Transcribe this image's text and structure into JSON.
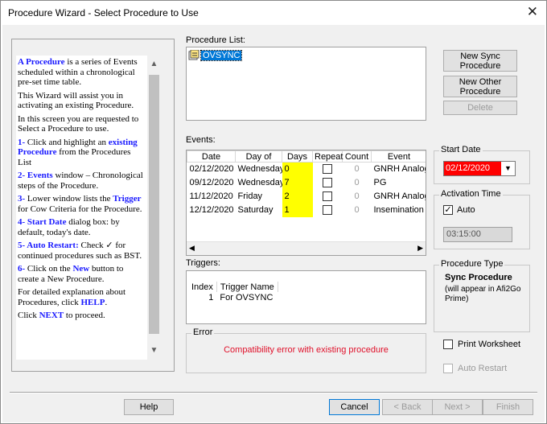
{
  "window": {
    "title": "Procedure Wizard - Select Procedure to Use",
    "close_glyph": "✕"
  },
  "help": [
    {
      "parts": [
        {
          "t": "A Procedure",
          "b": true
        },
        {
          "t": " is a series of Events scheduled within a chronological pre-set time table."
        }
      ]
    },
    {
      "parts": [
        {
          "t": "This Wizard will assist you in activating an existing Procedure."
        }
      ]
    },
    {
      "parts": [
        {
          "t": "In this screen you are requested to Select a Procedure to use."
        }
      ]
    },
    {
      "parts": [
        {
          "t": "1- ",
          "b": true
        },
        {
          "t": "Click and highlight an "
        },
        {
          "t": "existing Procedure",
          "b": true
        },
        {
          "t": " from the Procedures List"
        }
      ]
    },
    {
      "parts": [
        {
          "t": "2- Events",
          "b": true
        },
        {
          "t": " window – Chronological steps of the Procedure."
        }
      ]
    },
    {
      "parts": [
        {
          "t": "3- ",
          "b": true
        },
        {
          "t": "Lower window lists the "
        },
        {
          "t": "Trigger",
          "b": true
        },
        {
          "t": " for Cow Criteria for the Procedure."
        }
      ]
    },
    {
      "parts": [
        {
          "t": "4- Start Date",
          "b": true
        },
        {
          "t": " dialog box: by default, today's date."
        }
      ]
    },
    {
      "parts": [
        {
          "t": "5- Auto Restart:",
          "b": true
        },
        {
          "t": " Check ✓ for continued procedures such as BST."
        }
      ]
    },
    {
      "parts": [
        {
          "t": "6- ",
          "b": true
        },
        {
          "t": "Click on the "
        },
        {
          "t": "New",
          "b": true
        },
        {
          "t": " button to create a New Procedure."
        }
      ]
    },
    {
      "parts": [
        {
          "t": "For detailed explanation about Procedures, click "
        },
        {
          "t": "HELP",
          "b": true
        },
        {
          "t": "."
        }
      ]
    },
    {
      "parts": [
        {
          "t": "Click "
        },
        {
          "t": "NEXT",
          "b": true
        },
        {
          "t": " to proceed."
        }
      ]
    }
  ],
  "procedure_list": {
    "label": "Procedure List:",
    "items": [
      "OVSYNC"
    ],
    "selected": "OVSYNC"
  },
  "buttons": {
    "new_sync": "New Sync Procedure",
    "new_other": "New Other Procedure",
    "delete": "Delete",
    "help": "Help",
    "cancel": "Cancel",
    "back": "< Back",
    "next": "Next >",
    "finish": "Finish"
  },
  "events": {
    "label": "Events:",
    "columns": [
      "Date",
      "Day of",
      "Days",
      "Repeat",
      "Count",
      "Event"
    ],
    "rows": [
      {
        "date": "02/12/2020",
        "day": "Wednesday",
        "days": "0",
        "count": "0",
        "event": "GNRH Analog"
      },
      {
        "date": "09/12/2020",
        "day": "Wednesday",
        "days": "7",
        "count": "0",
        "event": "PG"
      },
      {
        "date": "11/12/2020",
        "day": "Friday",
        "days": "2",
        "count": "0",
        "event": "GNRH Analog"
      },
      {
        "date": "12/12/2020",
        "day": "Saturday",
        "days": "1",
        "count": "0",
        "event": "Insemination"
      }
    ]
  },
  "triggers": {
    "label": "Triggers:",
    "columns": [
      "Index",
      "Trigger Name"
    ],
    "rows": [
      {
        "index": "1",
        "name": "For OVSYNC"
      }
    ]
  },
  "error": {
    "label": "Error",
    "message": "Compatibility error with existing procedure",
    "color": "#e0102a"
  },
  "start_date": {
    "label": "Start Date",
    "value": "02/12/2020",
    "bg": "#ff0000"
  },
  "activation_time": {
    "label": "Activation Time",
    "auto_label": "Auto",
    "auto_checked": true,
    "value": "03:15:00"
  },
  "procedure_type": {
    "label": "Procedure Type",
    "type": "Sync Procedure",
    "note": "(will appear in Afi2Go Prime)"
  },
  "options": {
    "print_worksheet": "Print Worksheet",
    "auto_restart": "Auto Restart"
  }
}
